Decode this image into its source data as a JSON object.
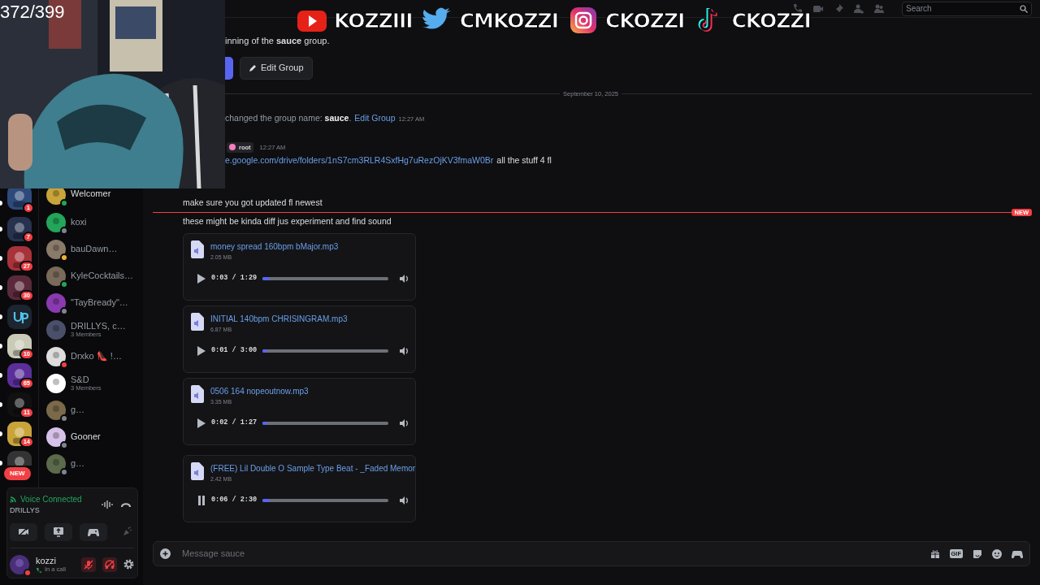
{
  "overlay": {
    "counter": "372/399",
    "socials": [
      {
        "kind": "youtube",
        "handle": "KOZZIII"
      },
      {
        "kind": "twitter",
        "handle": "CMKOZZI"
      },
      {
        "kind": "instagram",
        "handle": "CKOZZI"
      },
      {
        "kind": "tiktok",
        "handle": "CKOZZI"
      }
    ]
  },
  "servers": [
    {
      "badge": "1",
      "unread": true
    },
    {
      "badge": "7",
      "unread": true
    },
    {
      "badge": "27",
      "unread": true
    },
    {
      "badge": "30",
      "unread": true
    },
    {
      "unread": true
    },
    {
      "badge": "10",
      "unread": true
    },
    {
      "badge": "65",
      "unread": true
    },
    {
      "badge": "11",
      "unread": true
    },
    {
      "badge": "14",
      "unread": true
    },
    {
      "unread": true
    }
  ],
  "new_badge": "NEW",
  "direct_messages": [
    {
      "name": "Welcomer",
      "color": "#23a55a",
      "unread": true
    },
    {
      "name": "koxi",
      "color": "#80848e",
      "unread": false
    },
    {
      "name": "bauDawn…",
      "color": "#f0b232",
      "unread": false
    },
    {
      "name": "KyleCocktails…",
      "color": "#23a55a",
      "unread": false
    },
    {
      "name": "\"TayBready\"…",
      "color": "#80848e",
      "unread": false
    },
    {
      "name": "DRILLYS, c…",
      "subtitle": "3 Members",
      "unread": false
    },
    {
      "name": "Drxko 👠 !…",
      "color": "#f23f43",
      "unread": false
    },
    {
      "name": "S&D",
      "subtitle": "3 Members",
      "unread": false
    },
    {
      "name": "g…",
      "color": "#80848e",
      "unread": false
    },
    {
      "name": "Gooner",
      "color": "#80848e",
      "unread": true
    },
    {
      "name": "g…",
      "color": "#80848e",
      "unread": false
    }
  ],
  "voice": {
    "label": "Voice Connected",
    "channel": "DRILLYS"
  },
  "user": {
    "name": "kozzi",
    "activity": "In a call",
    "color": "#f23f43",
    "mic_muted": true,
    "deafened": true
  },
  "header": {
    "search": {
      "placeholder": "Search"
    }
  },
  "chat": {
    "intro": "inning of the **sauce** group.",
    "edit_button": "Edit Group",
    "date_divider": "September 10, 2025",
    "system_message": {
      "text": "changed the group name: **sauce**.",
      "link": "Edit Group",
      "time": "12:27 AM"
    },
    "message": {
      "role_tag": "root",
      "time": "12:27 AM",
      "link": "e.google.com/drive/folders/1nS7cm3RLR4SxfHg7uRezOjKV3fmaW0Br",
      "text": "all the stuff 4 fl"
    },
    "line_before_new": "make sure you got updated fl newest",
    "new_divider": "NEW",
    "line_after_new": "these might be kinda diff jus experiment and find sound",
    "attachments": [
      {
        "name": "money spread 160bpm bMajor.mp3",
        "size": "2.05 MB",
        "time": "0:03 / 1:29",
        "level": 0.06,
        "playing": false
      },
      {
        "name": "INITIAL 140bpm CHRISINGRAM.mp3",
        "size": "6.87 MB",
        "time": "0:01 / 3:00",
        "level": 0.04,
        "playing": false
      },
      {
        "name": "0506 164 nopeoutnow.mp3",
        "size": "3.35 MB",
        "time": "0:02 / 1:27",
        "level": 0.04,
        "playing": false
      },
      {
        "name": "(FREE) Lil Double O Sample Type Beat - _Faded Memor",
        "size": "2.42 MB",
        "time": "0:06 / 2:30",
        "level": 0.06,
        "playing": true
      }
    ]
  },
  "composer": {
    "placeholder": "Message sauce",
    "gif_label": "GIF"
  }
}
